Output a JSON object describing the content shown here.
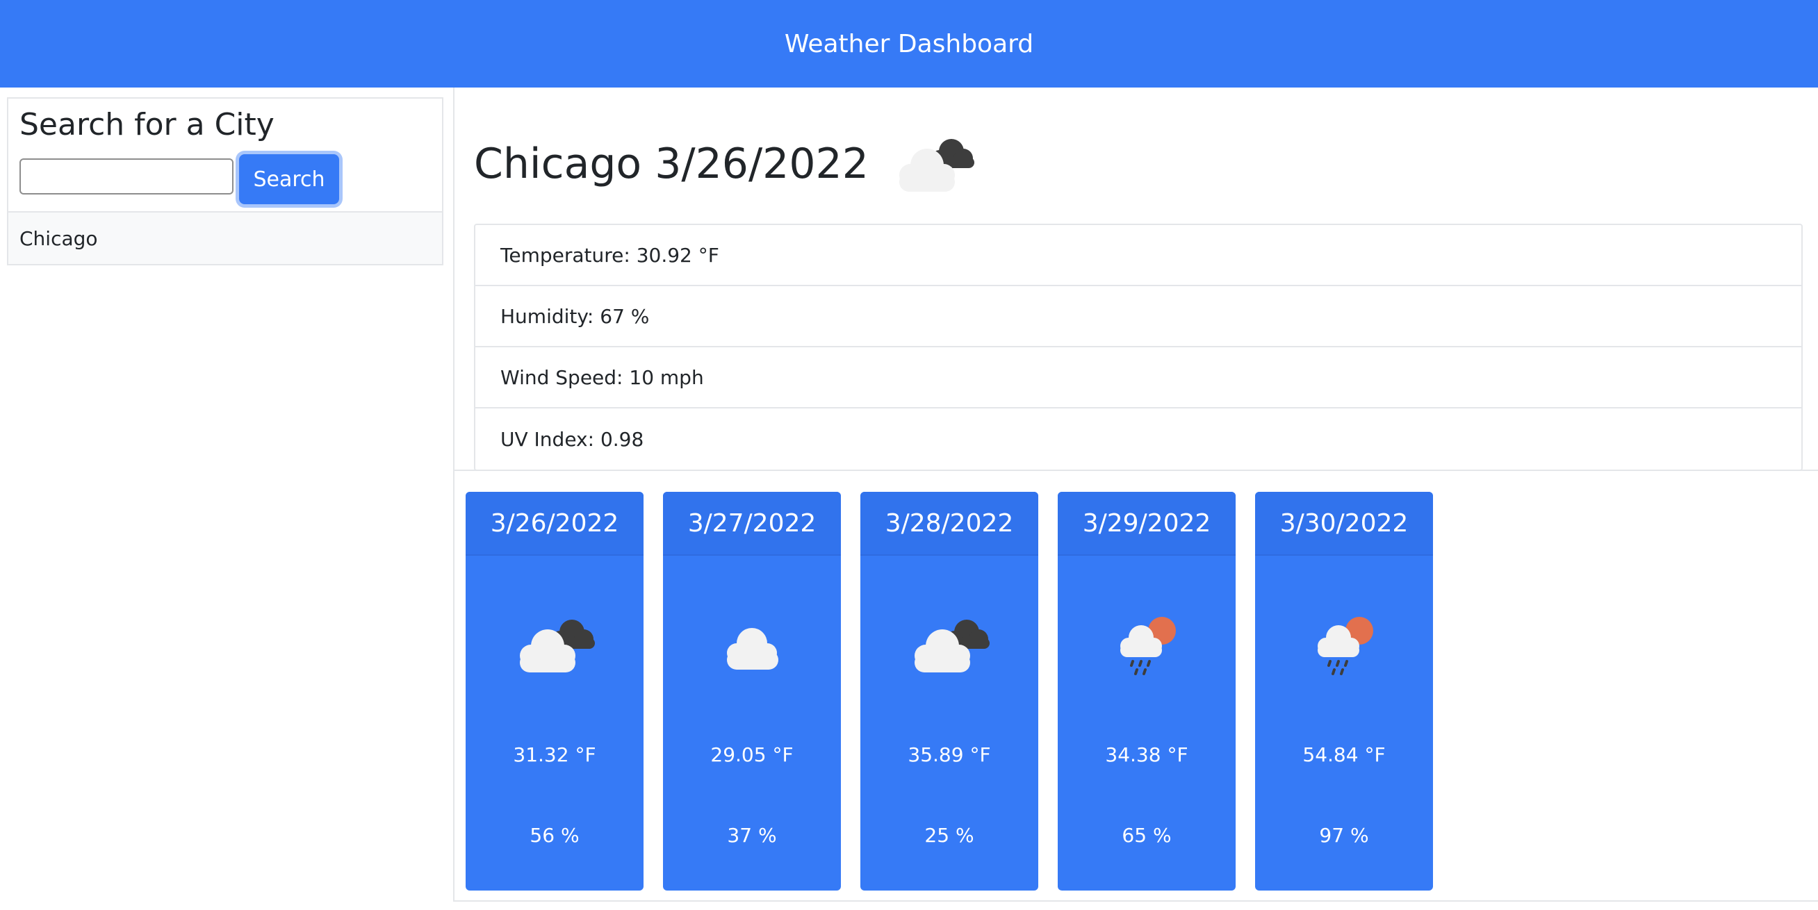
{
  "header": {
    "title": "Weather Dashboard"
  },
  "sidebar": {
    "title": "Search for a City",
    "search_value": "",
    "search_button": "Search",
    "history": [
      "Chicago"
    ]
  },
  "current": {
    "title": "Chicago 3/26/2022",
    "icon": "cloud-night-icon",
    "details": [
      "Temperature: 30.92 °F",
      "Humidity: 67 %",
      "Wind Speed: 10 mph",
      "UV Index: 0.98"
    ]
  },
  "forecast": [
    {
      "date": "3/26/2022",
      "icon": "cloud-night-icon",
      "temp": "31.32 °F",
      "humidity": "56 %"
    },
    {
      "date": "3/27/2022",
      "icon": "cloud-icon",
      "temp": "29.05 °F",
      "humidity": "37 %"
    },
    {
      "date": "3/28/2022",
      "icon": "cloud-night-icon",
      "temp": "35.89 °F",
      "humidity": "25 %"
    },
    {
      "date": "3/29/2022",
      "icon": "rain-sun-icon",
      "temp": "34.38 °F",
      "humidity": "65 %"
    },
    {
      "date": "3/30/2022",
      "icon": "rain-sun-icon",
      "temp": "54.84 °F",
      "humidity": "97 %"
    }
  ],
  "colors": {
    "primary": "#367af6",
    "card_header": "#3173ed",
    "border": "#e4e6e9"
  }
}
